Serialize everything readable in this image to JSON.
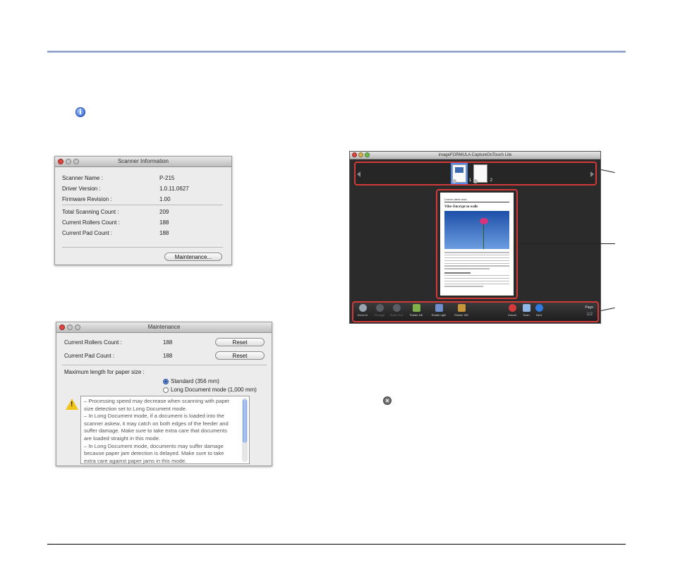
{
  "scanner_info": {
    "title": "Scanner Information",
    "rows": [
      {
        "label": "Scanner Name :",
        "value": "P-215"
      },
      {
        "label": "Driver Version :",
        "value": "1.0.11.0627"
      },
      {
        "label": "Firmware Revision :",
        "value": "1.00"
      },
      {
        "label": "Total Scanning Count :",
        "value": "209"
      },
      {
        "label": "Current Rollers Count :",
        "value": "188"
      },
      {
        "label": "Current Pad Count :",
        "value": "188"
      }
    ],
    "maintenance_label": "Maintenance..."
  },
  "maintenance": {
    "title": "Maintenance",
    "rollers_label": "Current Rollers Count :",
    "rollers_value": "188",
    "pad_label": "Current Pad Count :",
    "pad_value": "188",
    "reset_label": "Reset",
    "paper_size_label": "Maximum length for paper size :",
    "option_standard": "Standard (356 mm)",
    "option_long": "Long Document mode (1,000 mm)",
    "selected": "standard",
    "warning_lines": [
      "– Processing speed may decrease when scanning with paper",
      "size detection set to Long Document mode.",
      "– In Long Document mode, if a document is loaded into the",
      "scanner askew, it may catch on both edges of the feeder and",
      "suffer damage. Make sure to take extra care that documents",
      "are loaded straight in this mode.",
      "– In Long Document mode, documents may suffer damage",
      "because paper jam detection is delayed. Make sure to take",
      "extra care against paper jams in this mode."
    ]
  },
  "capture": {
    "title": "imageFORMULA CaptureOnTouch Lite",
    "thumbs": [
      {
        "num": "1"
      },
      {
        "num": "2"
      }
    ],
    "preview_heading": "Cosmos latest news",
    "preview_title": "Vibe–Encrypt to walls",
    "tools": [
      {
        "label": "Zoom In",
        "icon": "zoom-in-icon",
        "enabled": true,
        "color": "#9aa3b0"
      },
      {
        "label": "Fit page",
        "icon": "fit-page-icon",
        "enabled": false,
        "color": "#5a5f66"
      },
      {
        "label": "Zoom Out",
        "icon": "zoom-out-icon",
        "enabled": false,
        "color": "#5a5f66"
      },
      {
        "label": "Rotate left",
        "icon": "rotate-left-icon",
        "enabled": true,
        "color": "#7fb24a"
      },
      {
        "label": "Rotate right",
        "icon": "rotate-right-icon",
        "enabled": true,
        "color": "#6f8fcf"
      },
      {
        "label": "Rotate 180",
        "icon": "rotate-180-icon",
        "enabled": true,
        "color": "#c9963a"
      },
      {
        "label": "Cancel",
        "icon": "cancel-icon",
        "enabled": true,
        "color": "#d43a3a"
      },
      {
        "label": "Scan",
        "icon": "scan-icon",
        "enabled": true,
        "color": "#8fb6e6"
      },
      {
        "label": "Next",
        "icon": "next-icon",
        "enabled": true,
        "color": "#2f7be0"
      }
    ],
    "page_label": "Page",
    "page_number": "1/2"
  }
}
